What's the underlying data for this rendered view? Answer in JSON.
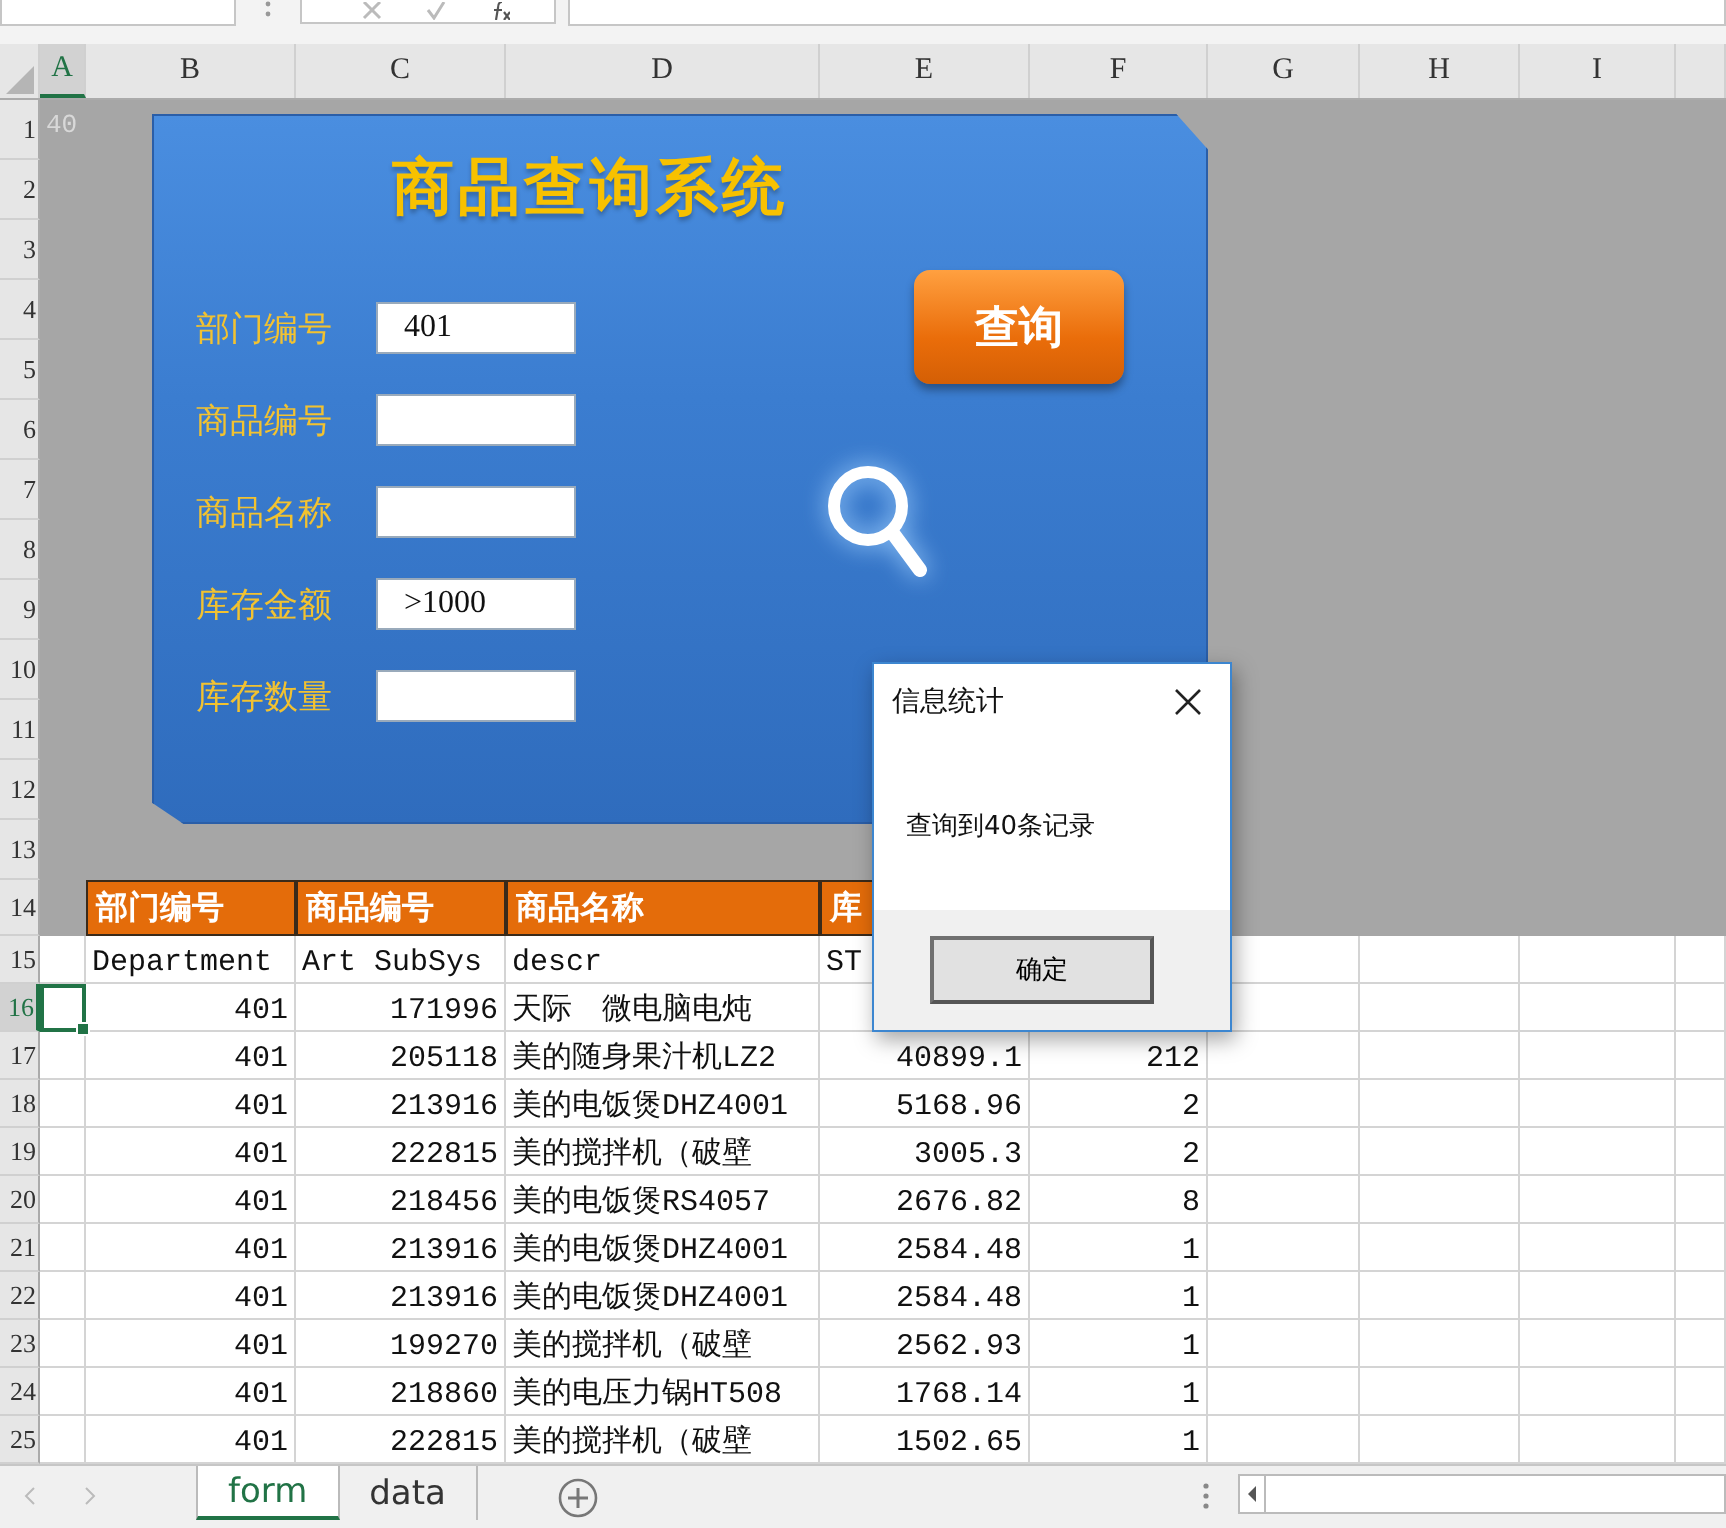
{
  "columns": [
    {
      "label": "A",
      "selected": true
    },
    {
      "label": "B",
      "selected": false
    },
    {
      "label": "C",
      "selected": false
    },
    {
      "label": "D",
      "selected": false
    },
    {
      "label": "E",
      "selected": false
    },
    {
      "label": "F",
      "selected": false
    },
    {
      "label": "G",
      "selected": false
    },
    {
      "label": "H",
      "selected": false
    },
    {
      "label": "I",
      "selected": false
    }
  ],
  "row_headers": [
    {
      "label": "1",
      "selected": false
    },
    {
      "label": "2",
      "selected": false
    },
    {
      "label": "3",
      "selected": false
    },
    {
      "label": "4",
      "selected": false
    },
    {
      "label": "5",
      "selected": false
    },
    {
      "label": "6",
      "selected": false
    },
    {
      "label": "7",
      "selected": false
    },
    {
      "label": "8",
      "selected": false
    },
    {
      "label": "9",
      "selected": false
    },
    {
      "label": "10",
      "selected": false
    },
    {
      "label": "11",
      "selected": false
    },
    {
      "label": "12",
      "selected": false
    },
    {
      "label": "13",
      "selected": false
    },
    {
      "label": "14",
      "selected": false
    },
    {
      "label": "15",
      "selected": false
    },
    {
      "label": "16",
      "selected": true
    },
    {
      "label": "17",
      "selected": false
    },
    {
      "label": "18",
      "selected": false
    },
    {
      "label": "19",
      "selected": false
    },
    {
      "label": "20",
      "selected": false
    },
    {
      "label": "21",
      "selected": false
    },
    {
      "label": "22",
      "selected": false
    },
    {
      "label": "23",
      "selected": false
    },
    {
      "label": "24",
      "selected": false
    },
    {
      "label": "25",
      "selected": false
    }
  ],
  "cell_a1": "40",
  "form": {
    "title": "商品查询系统",
    "fields": [
      {
        "label": "部门编号",
        "value": "401"
      },
      {
        "label": "商品编号"
      },
      {
        "label": "商品名称"
      },
      {
        "label": "库存金额",
        "value": ">1000"
      },
      {
        "label": "库存数量"
      }
    ],
    "query_button": "查询"
  },
  "table": {
    "header": [
      "部门编号",
      "商品编号",
      "商品名称",
      "库"
    ],
    "field_names": [
      "Department",
      "Art SubSys",
      "descr",
      "ST"
    ],
    "rows": [
      [
        "401",
        "171996",
        "天际　微电脑电炖"
      ],
      [
        "401",
        "205118",
        "美的随身果汁机LZ2",
        "40899.1",
        "212"
      ],
      [
        "401",
        "213916",
        "美的电饭煲DHZ4001",
        "5168.96",
        "2"
      ],
      [
        "401",
        "222815",
        "美的搅拌机（破壁",
        "3005.3",
        "2"
      ],
      [
        "401",
        "218456",
        "美的电饭煲RS4057",
        "2676.82",
        "8"
      ],
      [
        "401",
        "213916",
        "美的电饭煲DHZ4001",
        "2584.48",
        "1"
      ],
      [
        "401",
        "213916",
        "美的电饭煲DHZ4001",
        "2584.48",
        "1"
      ],
      [
        "401",
        "199270",
        "美的搅拌机（破壁",
        "2562.93",
        "1"
      ],
      [
        "401",
        "218860",
        "美的电压力锅HT508",
        "1768.14",
        "1"
      ],
      [
        "401",
        "222815",
        "美的搅拌机（破壁",
        "1502.65",
        "1"
      ]
    ]
  },
  "dialog": {
    "title": "信息统计",
    "message": "查询到40条记录",
    "ok_button": "确定"
  },
  "sheet_tabs": [
    {
      "label": "form",
      "selected": true
    },
    {
      "label": "data",
      "selected": false
    }
  ]
}
